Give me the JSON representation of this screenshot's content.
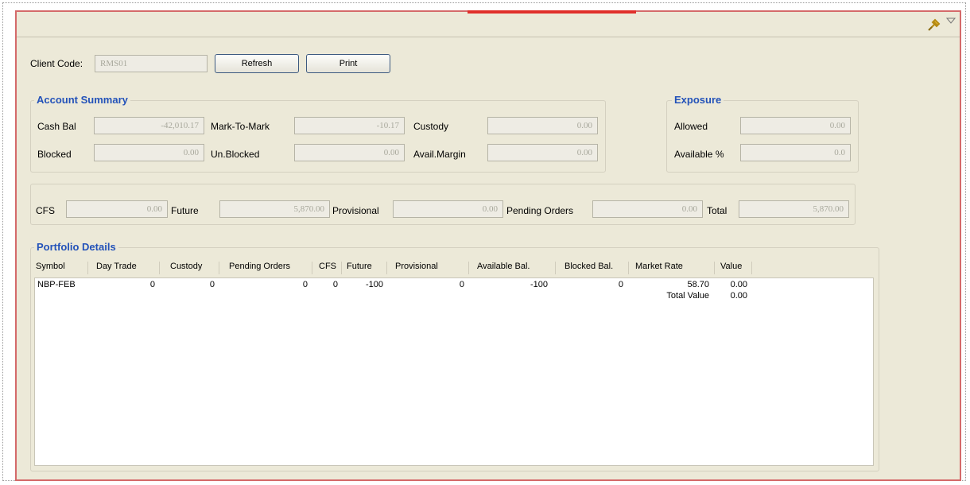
{
  "header": {
    "client_code_label": "Client Code:",
    "client_code_value": "RMS01",
    "refresh_label": "Refresh",
    "print_label": "Print",
    "icons": {
      "pin": "pin-icon",
      "menu": "view-menu-icon"
    }
  },
  "account_summary": {
    "title": "Account Summary",
    "cash_bal_label": "Cash Bal",
    "cash_bal_value": "-42,010.17",
    "mtm_label": "Mark-To-Mark",
    "mtm_value": "-10.17",
    "custody_label": "Custody",
    "custody_value": "0.00",
    "blocked_label": "Blocked",
    "blocked_value": "0.00",
    "unblocked_label": "Un.Blocked",
    "unblocked_value": "0.00",
    "avail_margin_label": "Avail.Margin",
    "avail_margin_value": "0.00"
  },
  "exposure": {
    "title": "Exposure",
    "allowed_label": "Allowed",
    "allowed_value": "0.00",
    "available_label": "Available %",
    "available_value": "0.0"
  },
  "totals": {
    "cfs_label": "CFS",
    "cfs_value": "0.00",
    "future_label": "Future",
    "future_value": "5,870.00",
    "provisional_label": "Provisional",
    "provisional_value": "0.00",
    "pending_label": "Pending Orders",
    "pending_value": "0.00",
    "total_label": "Total",
    "total_value": "5,870.00"
  },
  "portfolio": {
    "title": "Portfolio Details",
    "columns": [
      "Symbol",
      "Day Trade",
      "Custody",
      "Pending Orders",
      "CFS",
      "Future",
      "Provisional",
      "Available Bal.",
      "Blocked Bal.",
      "Market Rate",
      "Value"
    ],
    "rows": [
      [
        "NBP-FEB",
        "0",
        "0",
        "0",
        "0",
        "-100",
        "0",
        "-100",
        "0",
        "58.70",
        "0.00"
      ]
    ],
    "total_value_label": "Total Value",
    "total_value": "0.00"
  },
  "colors": {
    "window_bg": "#ece9d8",
    "group_title": "#2352b9",
    "frame_border": "#d46a6a",
    "accent_red": "#e0302a"
  }
}
